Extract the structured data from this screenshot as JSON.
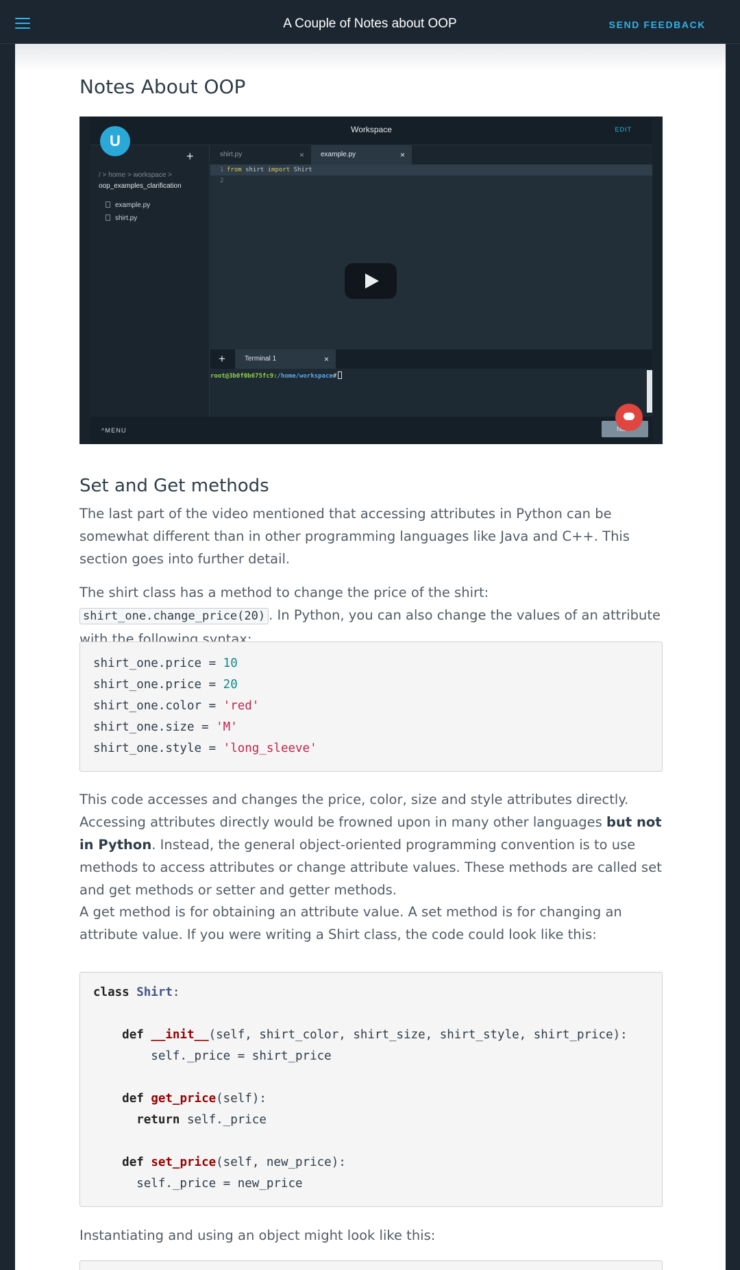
{
  "topbar": {
    "title": "A Couple of Notes about OOP",
    "feedback_label": "SEND FEEDBACK"
  },
  "page_title": "Notes About OOP",
  "video": {
    "workspace_title": "Workspace",
    "edit_label": "EDIT",
    "logo_glyph": "U",
    "plus_glyph": "+",
    "breadcrumb": "/ > home > workspace >",
    "folder": "oop_examples_clarification",
    "files": [
      "example.py",
      "shirt.py"
    ],
    "tabs": [
      "shirt.py",
      "example.py"
    ],
    "close_glyph": "×",
    "code_lines": [
      {
        "num": "1",
        "kw1": "from",
        "mid": " shirt ",
        "kw2": "import",
        "rest": " Shirt"
      },
      {
        "num": "2",
        "kw1": "",
        "mid": "",
        "kw2": "",
        "rest": ""
      }
    ],
    "terminal_tab": "Terminal 1",
    "terminal_user": "root@3b0f0b675fc9",
    "terminal_sep": ":",
    "terminal_path": "/home/workspace",
    "terminal_prompt": "#",
    "menu_label": "^MENU",
    "next_label": "NEXT"
  },
  "section": {
    "heading": "Set and Get methods",
    "p1": "The last part of the video mentioned that accessing attributes in Python can be somewhat different than in other programming languages like Java and C++. This section goes into further detail.",
    "p2_before": "The shirt class has a method to change the price of the shirt: ",
    "p2_code": "shirt_one.change_price(20)",
    "p2_after": ". In Python, you can also change the values of an attribute with the following syntax:",
    "code1": [
      {
        "a": "shirt_one.price = ",
        "v": "10",
        "t": "num"
      },
      {
        "a": "shirt_one.price = ",
        "v": "20",
        "t": "num"
      },
      {
        "a": "shirt_one.color = ",
        "v": "'red'",
        "t": "str"
      },
      {
        "a": "shirt_one.size = ",
        "v": "'M'",
        "t": "str"
      },
      {
        "a": "shirt_one.style = ",
        "v": "'long_sleeve'",
        "t": "str"
      }
    ],
    "p3_before": "This code accesses and changes the price, color, size and style attributes directly. Accessing attributes directly would be frowned upon in many other languages ",
    "p3_bold": "but not in Python",
    "p3_after": ". Instead, the general object-oriented programming convention is to use methods to access attributes or change attribute values. These methods are called set and get methods or setter and getter methods.",
    "p4": "A get method is for obtaining an attribute value. A set method is for changing an attribute value. If you were writing a Shirt class, the code could look like this:",
    "code2": {
      "class_kw": "class",
      "class_name": "Shirt",
      "colon": ":",
      "def_kw": "def",
      "return_kw": "return",
      "init_name": "__init__",
      "init_args": "(self, shirt_color, shirt_size, shirt_style, shirt_price):",
      "init_body": "self._price = shirt_price",
      "get_name": "get_price",
      "get_args": "(self):",
      "get_body": " self._price",
      "set_name": "set_price",
      "set_args": "(self, new_price):",
      "set_body": "self._price = new_price"
    },
    "p5": "Instantiating and using an object might look like this:"
  },
  "colors": {
    "accent": "#2fb3e8",
    "background": "#1c2630",
    "heading": "#2e3d49",
    "body_text": "#525c65",
    "number": "#0f8a8a",
    "string": "#c0254e",
    "function": "#990000",
    "class_name": "#445588"
  },
  "icons": [
    "hamburger-icon",
    "udacity-logo",
    "plus-icon",
    "file-icon",
    "close-icon",
    "play-icon",
    "chat-icon"
  ]
}
